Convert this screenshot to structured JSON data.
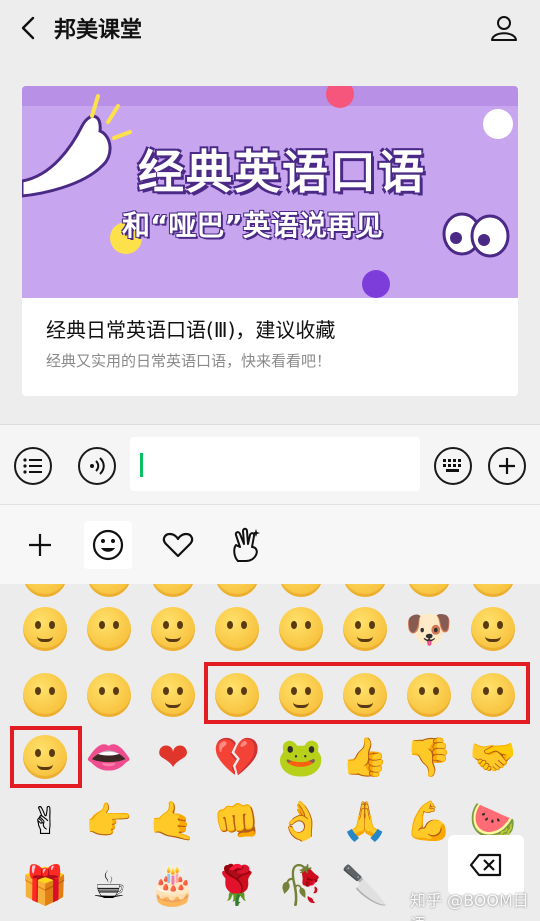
{
  "header": {
    "title": "邦美课堂",
    "back_icon": "chevron-left-icon",
    "profile_icon": "person-icon"
  },
  "card": {
    "banner_heading": "经典英语口语",
    "banner_subheading": "和“哑巴”英语说再见",
    "title": "经典日常英语口语(Ⅲ)，建议收藏",
    "description": "经典又实用的日常英语口语，快来看看吧！"
  },
  "input_bar": {
    "left_icons": [
      "list-icon",
      "voice-icon"
    ],
    "right_icons": [
      "keyboard-icon",
      "plus-circle-icon"
    ],
    "text_value": "",
    "accent": "#07c160"
  },
  "tabs": [
    {
      "icon": "plus-icon"
    },
    {
      "icon": "smiley-icon",
      "active": true
    },
    {
      "icon": "heart-icon"
    },
    {
      "icon": "hand-icon"
    }
  ],
  "highlight_color": "#e31b23",
  "delete_icon": "backspace-icon",
  "watermark": "知乎 @BOOM日语"
}
